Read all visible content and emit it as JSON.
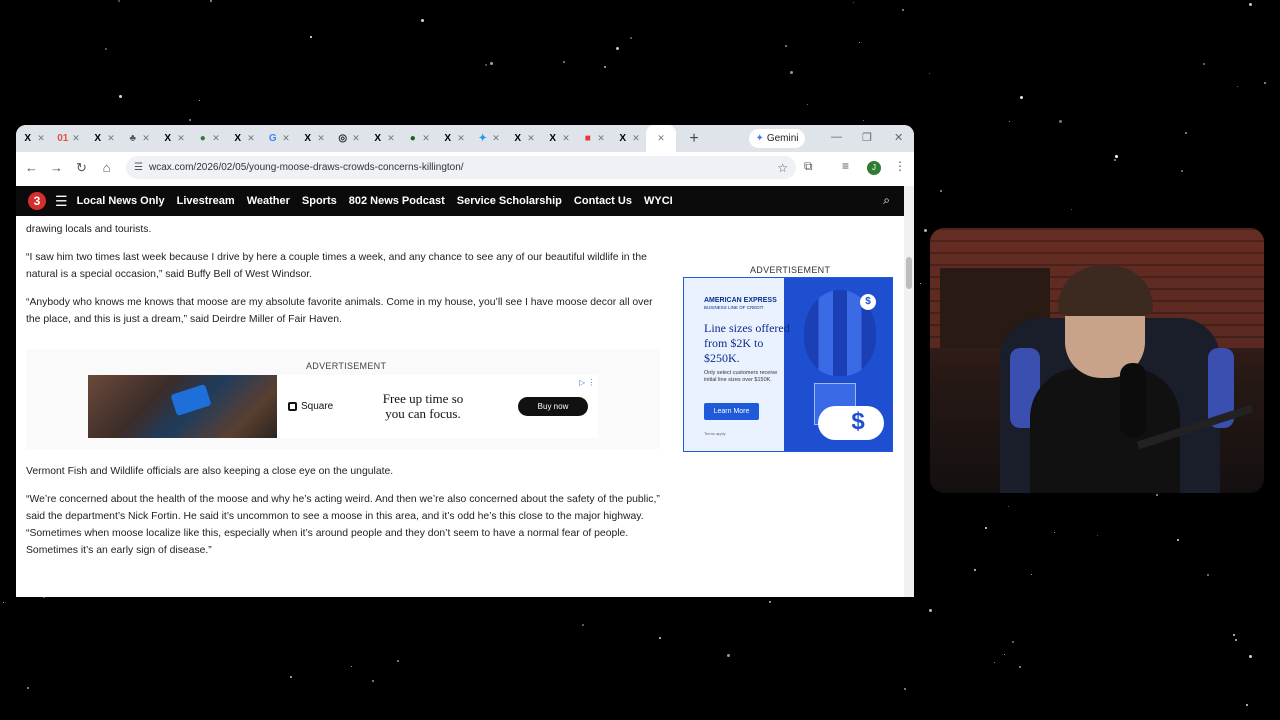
{
  "browser": {
    "tabs": [
      {
        "icon": "x-logo-icon",
        "glyph": "X"
      },
      {
        "icon": "news-favicon-icon",
        "glyph": "01"
      },
      {
        "icon": "x-logo-icon",
        "glyph": "X"
      },
      {
        "icon": "bear-favicon-icon",
        "glyph": "♣"
      },
      {
        "icon": "x-logo-icon",
        "glyph": "X"
      },
      {
        "icon": "green-favicon-icon",
        "glyph": "●"
      },
      {
        "icon": "x-logo-icon",
        "glyph": "X"
      },
      {
        "icon": "google-favicon-icon",
        "glyph": "G"
      },
      {
        "icon": "x-logo-icon",
        "glyph": "X"
      },
      {
        "icon": "github-favicon-icon",
        "glyph": "◎"
      },
      {
        "icon": "x-logo-icon",
        "glyph": "X"
      },
      {
        "icon": "green-circle-favicon-icon",
        "glyph": "●"
      },
      {
        "icon": "x-logo-icon",
        "glyph": "X"
      },
      {
        "icon": "blue-bird-favicon-icon",
        "glyph": "✦"
      },
      {
        "icon": "x-logo-icon",
        "glyph": "X"
      },
      {
        "icon": "x-logo-icon",
        "glyph": "X"
      },
      {
        "icon": "red-square-favicon-icon",
        "glyph": "■"
      },
      {
        "icon": "x-logo-icon",
        "glyph": "X"
      }
    ],
    "gemini_label": "Gemini",
    "url": "wcax.com/2026/02/05/young-moose-draws-crowds-concerns-killington/"
  },
  "site": {
    "logo_text": "3",
    "nav": [
      "Local News Only",
      "Livestream",
      "Weather",
      "Sports",
      "802 News Podcast",
      "Service Scholarship",
      "Contact Us",
      "WYCI"
    ]
  },
  "article": {
    "para_0": "drawing locals and tourists.",
    "para_1": "“I saw him two times last week because I drive by here a couple times a week, and any chance to see any of our beautiful wildlife in the natural is a special occasion,” said Buffy Bell of West Windsor.",
    "para_2": "“Anybody who knows me knows that moose are my absolute favorite animals. Come in my house, you’ll see I have moose decor all over the place, and this is just a dream,” said Deirdre Miller of Fair Haven.",
    "para_3": "Vermont Fish and Wildlife officials are also keeping a close eye on the ungulate.",
    "para_4": "“We’re concerned about the health of the moose and why he’s acting weird. And then we’re also concerned about the safety of the public,” said the department’s Nick Fortin. He said it’s uncommon to see a moose in this area, and it’s odd he’s this close to the major highway. “Sometimes when moose localize like this, especially when it’s around people and they don’t seem to have a normal fear of people. Sometimes it’s an early sign of disease.”"
  },
  "inline_ad": {
    "label": "ADVERTISEMENT",
    "brand": "Square",
    "tagline": "Free up time so you can focus.",
    "cta": "Buy now"
  },
  "side_ad": {
    "label": "ADVERTISEMENT",
    "brand": "AMERICAN EXPRESS",
    "subbrand": "BUSINESS LINE OF CREDIT",
    "headline": "Line sizes offered from $2K to $250K.",
    "fine_print": "Only select customers receive initial line sizes over $150K.",
    "cta": "Learn More",
    "terms": "Terms apply",
    "dollar": "$"
  },
  "colors": {
    "nav_bg": "#0b0b0b",
    "logo_red": "#d32f2f",
    "amex_blue": "#1f4fd1"
  }
}
